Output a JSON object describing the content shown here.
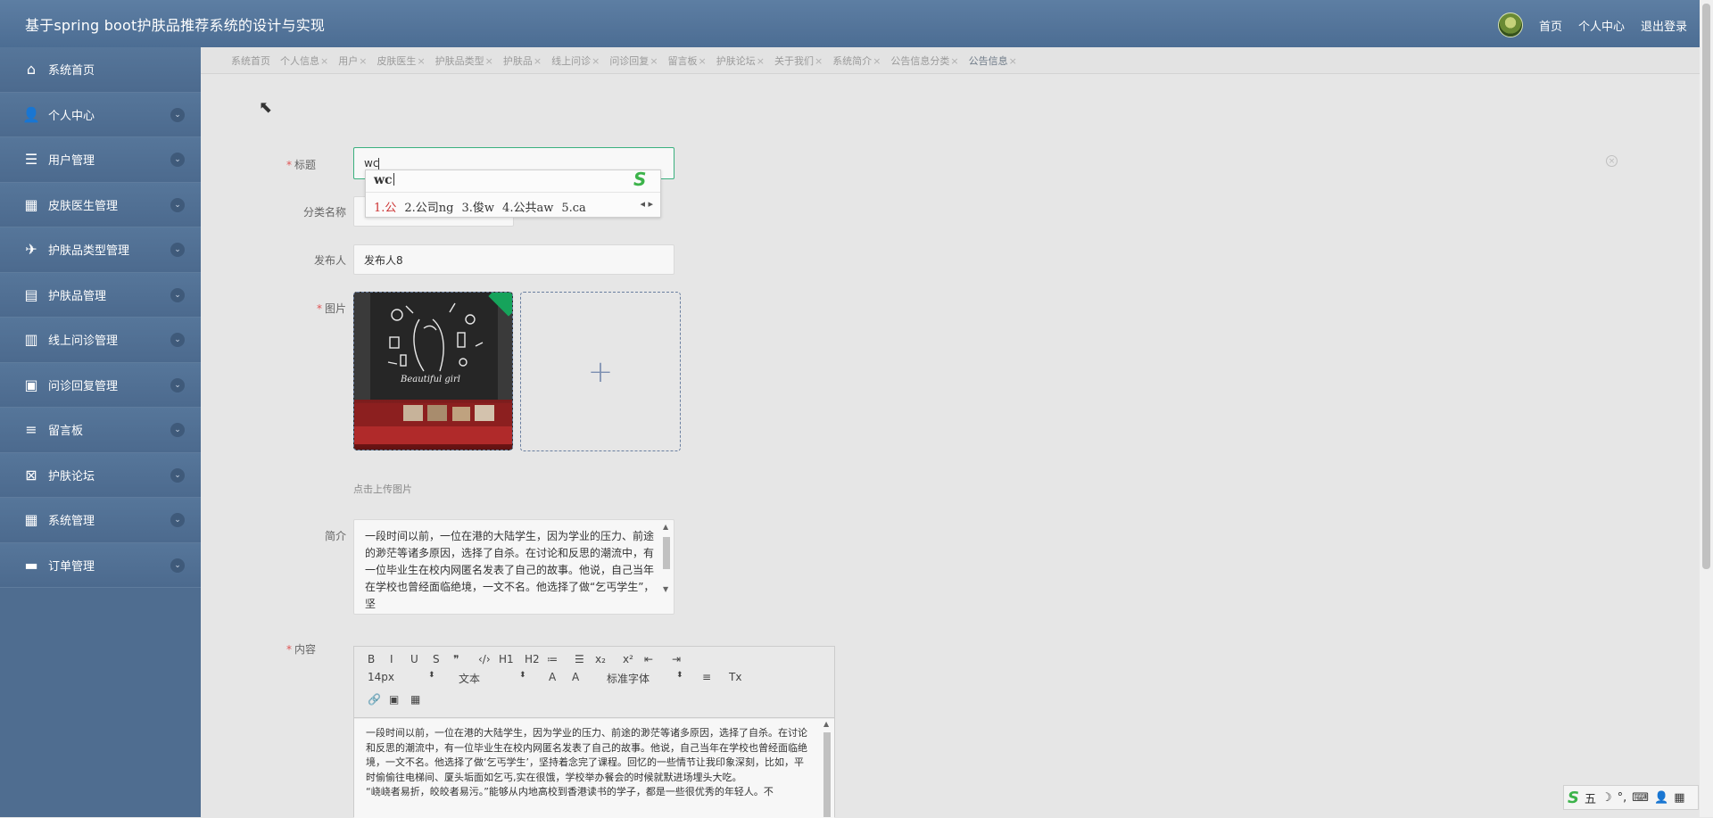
{
  "header": {
    "app_title": "基于spring boot护肤品推荐系统的设计与实现",
    "nav": [
      "首页",
      "个人中心",
      "退出登录"
    ]
  },
  "sidebar": {
    "items": [
      {
        "label": "系统首页",
        "icon": "home-icon",
        "glyph": "⌂",
        "expandable": false
      },
      {
        "label": "个人中心",
        "icon": "user-icon",
        "glyph": "👤",
        "expandable": true
      },
      {
        "label": "用户管理",
        "icon": "sliders-icon",
        "glyph": "☰",
        "expandable": true
      },
      {
        "label": "皮肤医生管理",
        "icon": "grid-icon",
        "glyph": "▦",
        "expandable": true
      },
      {
        "label": "护肤品类型管理",
        "icon": "paper-plane-icon",
        "glyph": "✈",
        "expandable": true
      },
      {
        "label": "护肤品管理",
        "icon": "briefcase-icon",
        "glyph": "▤",
        "expandable": true
      },
      {
        "label": "线上问诊管理",
        "icon": "clipboard-icon",
        "glyph": "▥",
        "expandable": true
      },
      {
        "label": "问诊回复管理",
        "icon": "wallet-icon",
        "glyph": "▣",
        "expandable": true
      },
      {
        "label": "留言板",
        "icon": "list-icon",
        "glyph": "≡",
        "expandable": true
      },
      {
        "label": "护肤论坛",
        "icon": "close-square-icon",
        "glyph": "⊠",
        "expandable": true
      },
      {
        "label": "系统管理",
        "icon": "grid-icon",
        "glyph": "▦",
        "expandable": true
      },
      {
        "label": "订单管理",
        "icon": "ticket-icon",
        "glyph": "▬",
        "expandable": true
      }
    ]
  },
  "tabs": [
    {
      "label": "系统首页",
      "closable": false
    },
    {
      "label": "个人信息",
      "closable": true
    },
    {
      "label": "用户",
      "closable": true
    },
    {
      "label": "皮肤医生",
      "closable": true
    },
    {
      "label": "护肤品类型",
      "closable": true
    },
    {
      "label": "护肤品",
      "closable": true
    },
    {
      "label": "线上问诊",
      "closable": true
    },
    {
      "label": "问诊回复",
      "closable": true
    },
    {
      "label": "留言板",
      "closable": true
    },
    {
      "label": "护肤论坛",
      "closable": true
    },
    {
      "label": "关于我们",
      "closable": true
    },
    {
      "label": "系统简介",
      "closable": true
    },
    {
      "label": "公告信息分类",
      "closable": true
    },
    {
      "label": "公告信息",
      "closable": true,
      "active": true
    }
  ],
  "form": {
    "title_label": "标题",
    "title_value": "wc",
    "category_label": "分类名称",
    "publisher_label": "发布人",
    "publisher_value": "发布人8",
    "image_label": "图片",
    "image_caption": "Beautiful girl",
    "upload_plus": "+",
    "upload_hint": "点击上传图片",
    "summary_label": "简介",
    "summary_text": "一段时间以前，一位在港的大陆学生，因为学业的压力、前途的渺茫等诸多原因，选择了自杀。在讨论和反思的潮流中，有一位毕业生在校内网匿名发表了自己的故事。他说，自己当年在学校也曾经面临绝境，一文不名。他选择了做“乞丐学生”，坚",
    "content_label": "内容",
    "content_text": "一段时间以前，一位在港的大陆学生，因为学业的压力、前途的渺茫等诸多原因，选择了自杀。在讨论和反思的潮流中，有一位毕业生在校内网匿名发表了自己的故事。他说，自己当年在学校也曾经面临绝境，一文不名。他选择了做‘乞丐学生’，坚持着念完了课程。回忆的一些情节让我印象深刻，比如，平时偷偷往电梯间、厦头垢面如乞丐,实在很饿，学校举办餐会的时候就默进场埋头大吃。",
    "content_text_2": "“峣峣者易折，皎皎者易污。”能够从内地高校到香港读书的学子，都是一些很优秀的年轻人。不"
  },
  "ime": {
    "composition": "wc",
    "candidates": [
      "1.公",
      "2.公司ng",
      "3.俊w",
      "4.公共aw",
      "5.ca"
    ],
    "arrows": "◂ ▸"
  },
  "editor": {
    "size_value": "14px",
    "format_value": "文本",
    "font_value": "标准字体",
    "buttons": [
      "B",
      "I",
      "U",
      "S",
      "❞",
      "‹/›",
      "H1",
      "H2",
      "≔",
      "☰",
      "x₂",
      "x²",
      "⇤",
      "⇥"
    ],
    "row2_tail": [
      "A",
      "A",
      "≡",
      "Tx"
    ],
    "row3": [
      "🔗",
      "▣",
      "▦"
    ]
  },
  "tray": {
    "logo": "S",
    "items": [
      "五",
      "☽",
      "°,",
      "⌨",
      "👤",
      "▦"
    ]
  }
}
